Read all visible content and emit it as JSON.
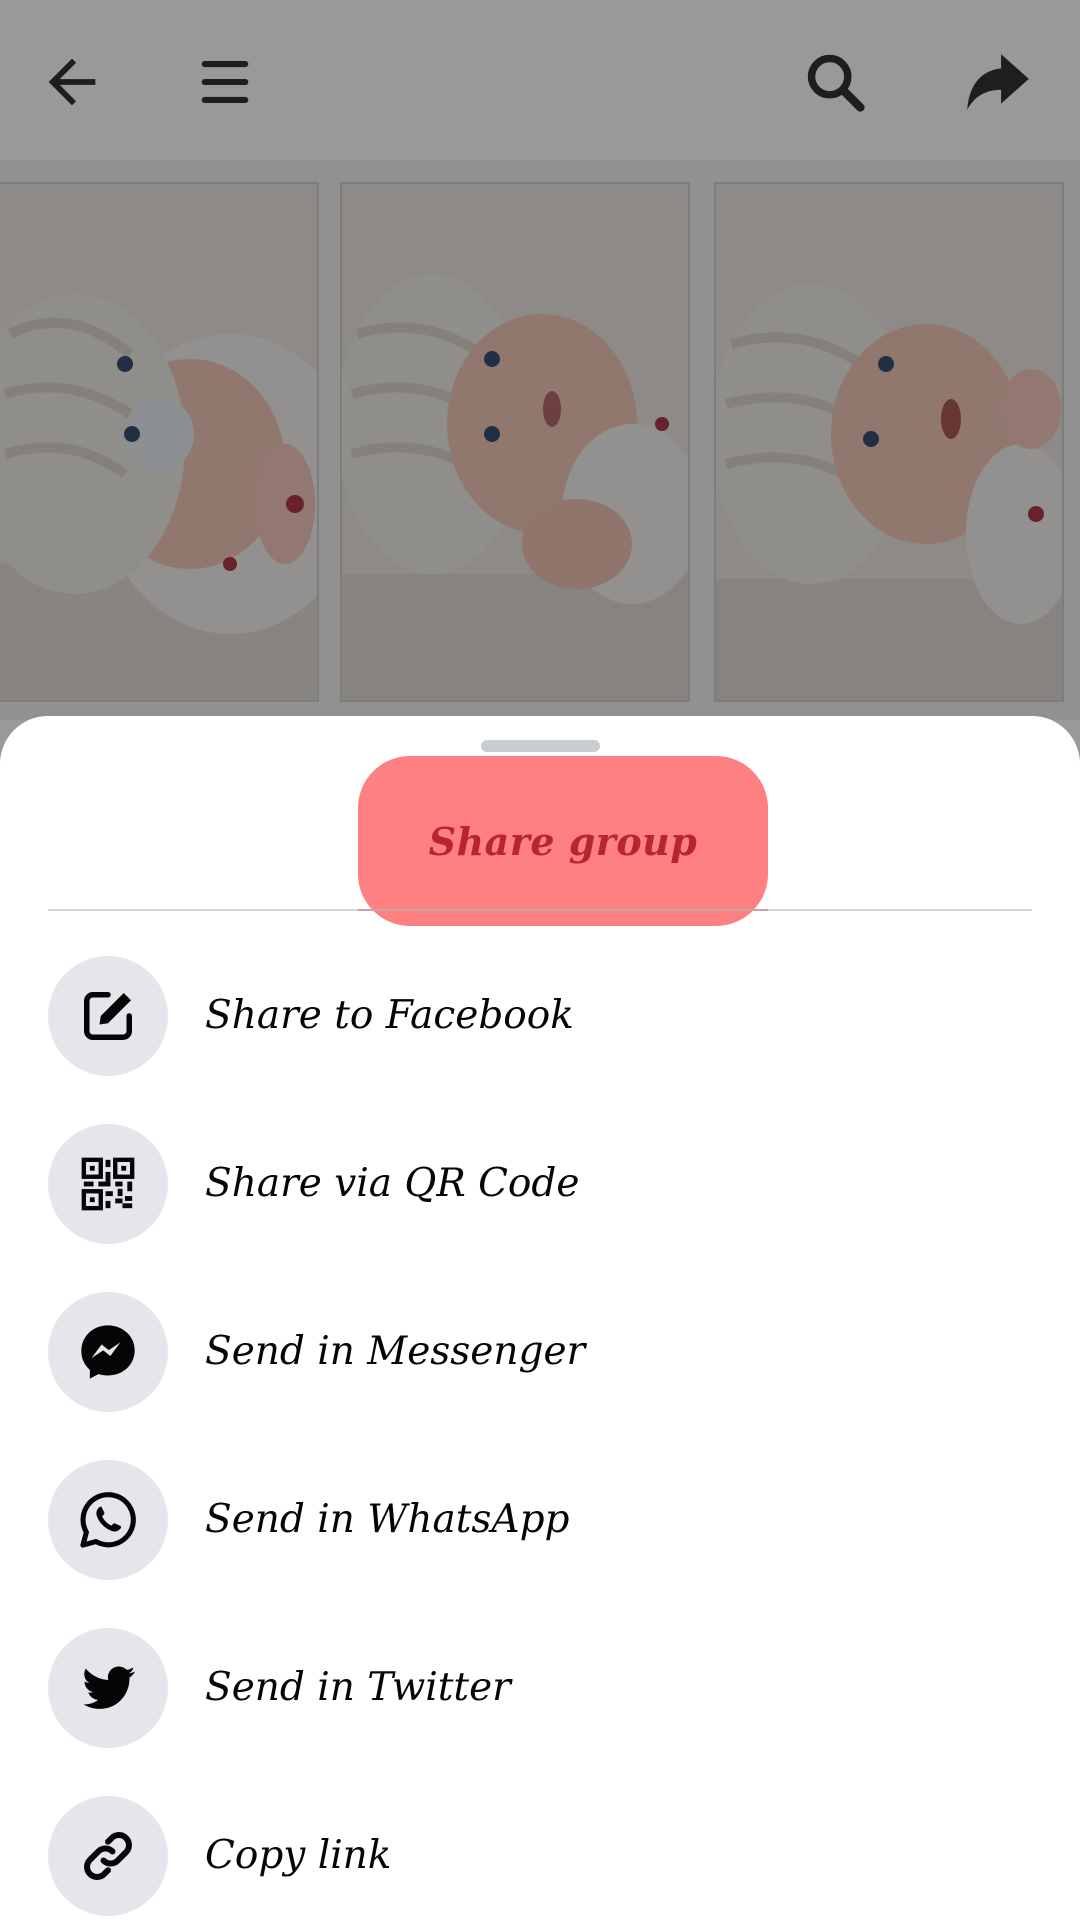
{
  "topbar": {
    "icons": [
      "back-arrow-icon",
      "hamburger-menu-icon",
      "search-icon",
      "share-arrow-icon"
    ]
  },
  "photos": {
    "count": 3,
    "subject": "baby-photo"
  },
  "sheet": {
    "title": "Share group",
    "title_highlight_color": "#ff8080",
    "title_text_color": "#b7262c",
    "options": [
      {
        "label": "Share to Facebook",
        "icon": "edit-compose-icon"
      },
      {
        "label": "Share via QR Code",
        "icon": "qr-code-icon"
      },
      {
        "label": "Send in Messenger",
        "icon": "messenger-icon"
      },
      {
        "label": "Send in WhatsApp",
        "icon": "whatsapp-icon"
      },
      {
        "label": "Send in Twitter",
        "icon": "twitter-icon"
      },
      {
        "label": "Copy link",
        "icon": "link-icon"
      }
    ]
  },
  "colors": {
    "scrim": "rgba(0,0,0,0.40)",
    "icon_circle": "#e4e6eb",
    "text": "#050505"
  }
}
